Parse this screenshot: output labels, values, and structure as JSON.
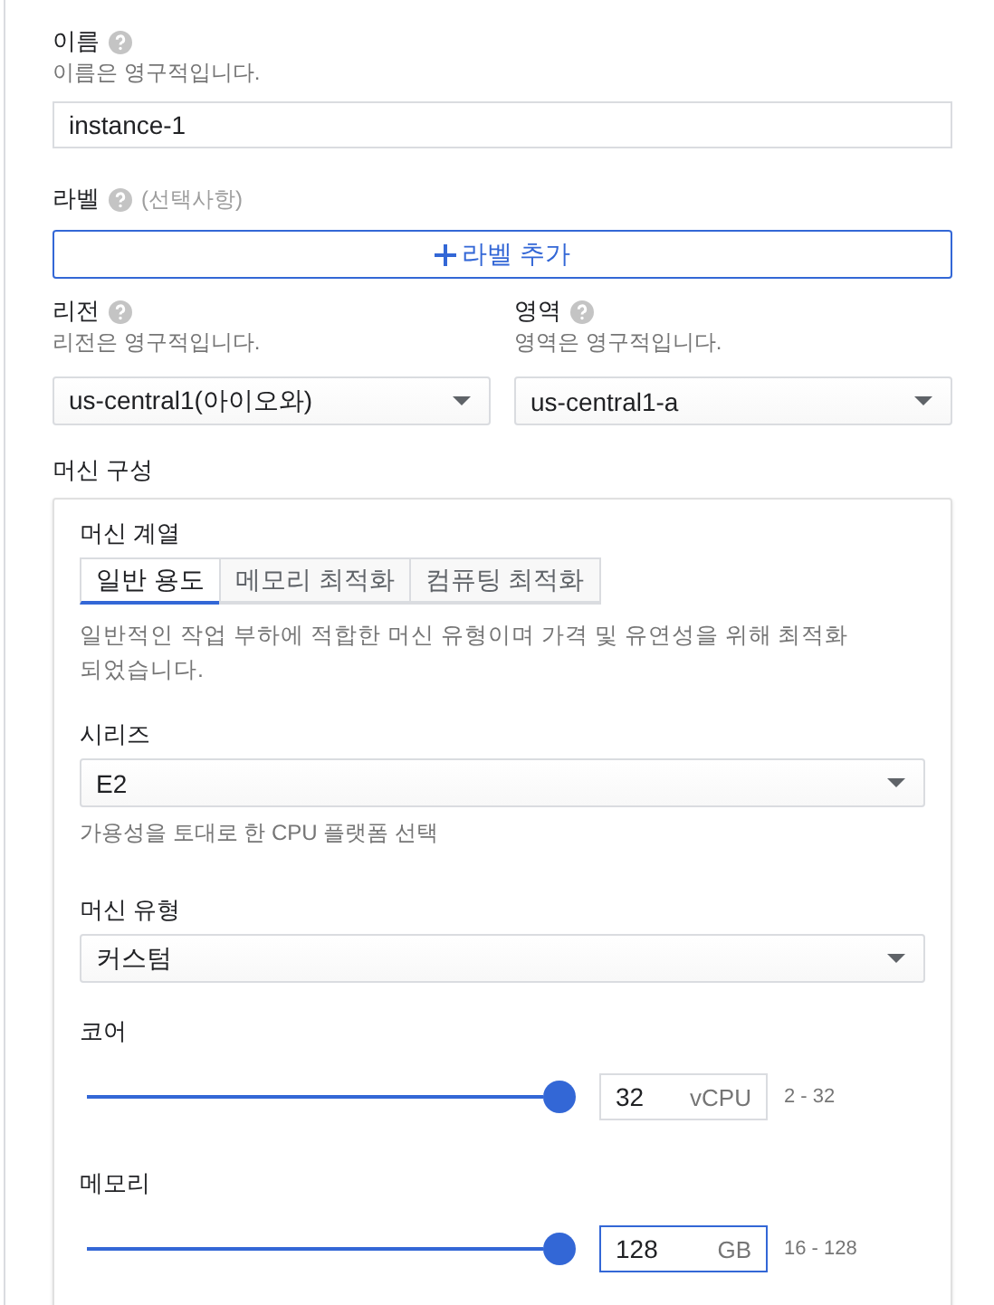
{
  "name": {
    "label": "이름",
    "hint": "이름은 영구적입니다.",
    "value": "instance-1"
  },
  "labels": {
    "label": "라벨",
    "optional": "(선택사항)",
    "button": "라벨 추가"
  },
  "location": [
    {
      "label": "리전",
      "hint": "리전은 영구적입니다.",
      "value": "us-central1(아이오와)"
    },
    {
      "label": "영역",
      "hint": "영역은 영구적입니다.",
      "value": "us-central1-a"
    }
  ],
  "machine_config": {
    "title": "머신 구성",
    "family_label": "머신 계열",
    "tabs": [
      {
        "label": "일반 용도",
        "selected": true
      },
      {
        "label": "메모리 최적화",
        "selected": false
      },
      {
        "label": "컴퓨팅 최적화",
        "selected": false
      }
    ],
    "description": "일반적인 작업 부하에 적합한 머신 유형이며 가격 및 유연성을 위해 최적화되었습니다.",
    "series": {
      "label": "시리즈",
      "value": "E2",
      "hint": "가용성을 토대로 한 CPU 플랫폼 선택"
    },
    "machine_type": {
      "label": "머신 유형",
      "value": "커스텀"
    },
    "sliders": [
      {
        "label": "코어",
        "level": 1,
        "value": "32",
        "unit": "vCPU",
        "range": "2 - 32",
        "focused": false
      },
      {
        "label": "메모리",
        "level": 1,
        "value": "128",
        "unit": "GB",
        "range": "16 - 128",
        "focused": true
      }
    ]
  }
}
